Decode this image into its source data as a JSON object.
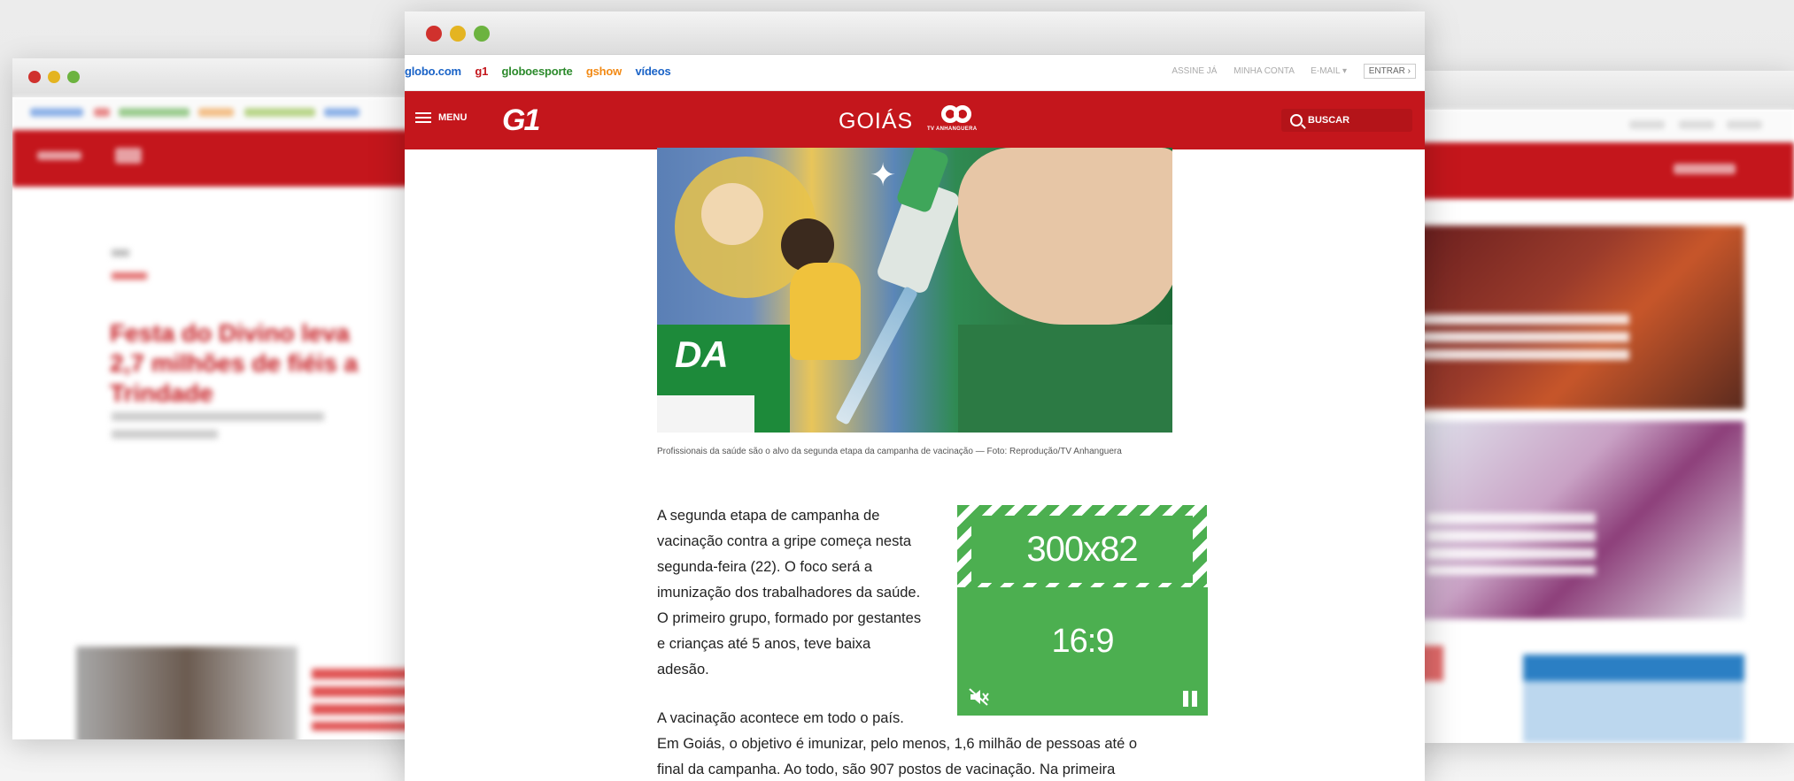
{
  "main": {
    "topbar": {
      "sites": [
        {
          "label": "globo.com",
          "color": "#1a63c7"
        },
        {
          "label": "g1",
          "color": "#c4161c"
        },
        {
          "label": "globoesporte",
          "color": "#2c8a2c"
        },
        {
          "label": "gshow",
          "color": "#f28a15"
        },
        {
          "label": "vídeos",
          "color": "#1a63c7"
        }
      ],
      "account": {
        "assine": "ASSINE JÁ",
        "minha_conta": "MINHA CONTA",
        "email": "E-MAIL ▾",
        "entrar": "ENTRAR ›"
      }
    },
    "header": {
      "menu_label": "MENU",
      "logo": "G1",
      "region": "GOIÁS",
      "affiliate": "TV ANHANGUERA",
      "search_label": "BUSCAR"
    },
    "article": {
      "caption": "Profissionais da saúde são o alvo da segunda etapa da campanha de vacinação — Foto: Reprodução/TV Anhanguera",
      "paragraph_1": "A segunda etapa de campanha de vacinação contra a gripe começa nesta segunda-feira (22). O foco será a imunização dos trabalhadores da saúde. O primeiro grupo, formado por gestantes e crianças até 5 anos, teve baixa adesão.",
      "paragraph_2_line1": "A vacinação acontece em todo o país.",
      "paragraph_2_line2": "Em Goiás, o objetivo é imunizar, pelo menos, 1,6 milhão de pessoas até o",
      "paragraph_2_line3": "final da campanha. Ao todo, são 907 postos de vacinação. Na primeira"
    },
    "ads": {
      "banner_label": "300x82",
      "video_label": "16:9",
      "color": "#4caf50"
    }
  },
  "left_window": {
    "headline": "Festa do Divino leva 2,7 milhões de fiéis a Trindade"
  },
  "colors": {
    "brand_red": "#c4161c",
    "dot_red": "#d0312d",
    "dot_yellow": "#e4b421",
    "dot_green": "#6cb33f"
  }
}
